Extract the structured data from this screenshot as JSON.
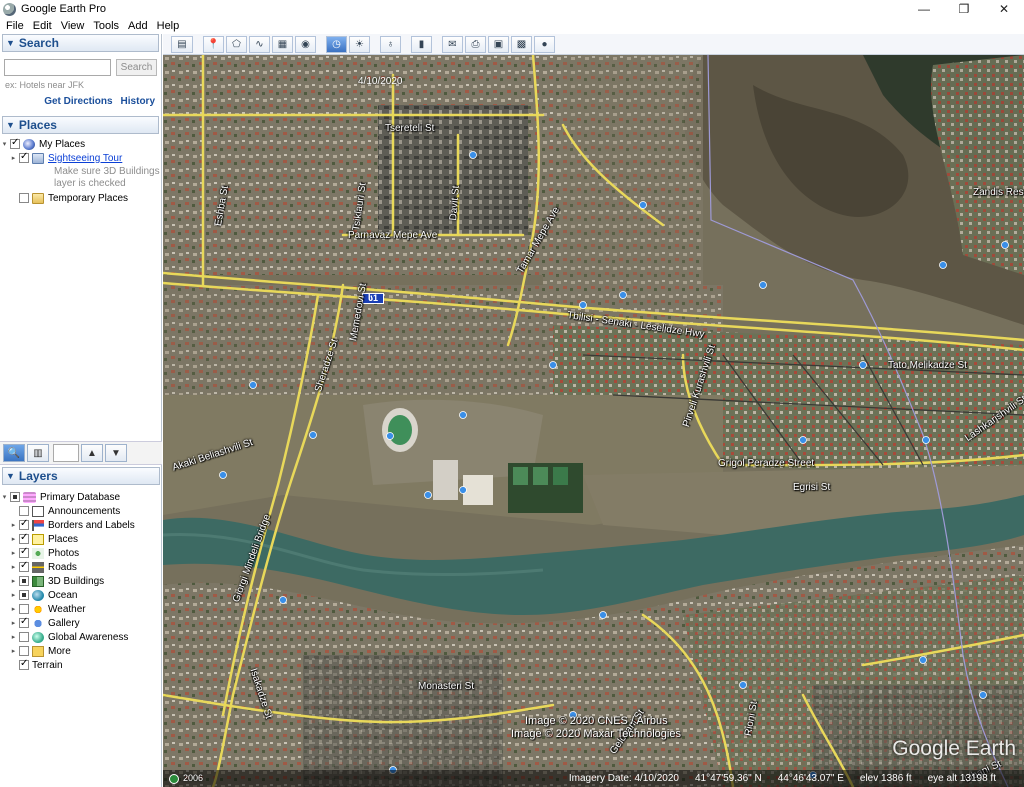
{
  "window": {
    "title": "Google Earth Pro",
    "minimize": "—",
    "maximize": "❐",
    "close": "✕"
  },
  "menu": [
    "File",
    "Edit",
    "View",
    "Tools",
    "Add",
    "Help"
  ],
  "search": {
    "header": "Search",
    "placeholder": "",
    "button": "Search",
    "hint": "ex: Hotels near JFK",
    "get_directions": "Get Directions",
    "history": "History"
  },
  "places": {
    "header": "Places",
    "my_places": "My Places",
    "sightseeing_tour": "Sightseeing Tour",
    "note_line1": "Make sure 3D Buildings",
    "note_line2": "layer is checked",
    "temporary_places": "Temporary Places"
  },
  "layers": {
    "header": "Layers",
    "primary_database": "Primary Database",
    "items": [
      {
        "label": "Announcements",
        "checked": false,
        "icon": "envelope-icon"
      },
      {
        "label": "Borders and Labels",
        "checked": true,
        "icon": "flag-icon"
      },
      {
        "label": "Places",
        "checked": true,
        "icon": "places-pin-icon"
      },
      {
        "label": "Photos",
        "checked": true,
        "icon": "photo-icon"
      },
      {
        "label": "Roads",
        "checked": true,
        "icon": "road-icon"
      },
      {
        "label": "3D Buildings",
        "checked": "partial",
        "icon": "building-icon"
      },
      {
        "label": "Ocean",
        "checked": "partial",
        "icon": "ocean-icon"
      },
      {
        "label": "Weather",
        "checked": false,
        "icon": "weather-icon"
      },
      {
        "label": "Gallery",
        "checked": true,
        "icon": "gallery-star-icon"
      },
      {
        "label": "Global Awareness",
        "checked": false,
        "icon": "globe-icon"
      },
      {
        "label": "More",
        "checked": false,
        "icon": "more-icon"
      }
    ],
    "terrain": "Terrain"
  },
  "map": {
    "date_overlay": "4/10/2020",
    "highway_shield": "ს1",
    "labels": {
      "grigol_peradze": "Grigol Peradze Street",
      "egrisi": "Egrisi St",
      "monasteri": "Monasteri St",
      "isakadze": "Isakadze St",
      "gelovani": "Gelovani St",
      "rioni": "Rioni St",
      "libani": "Libani St",
      "tato_melikadze": "Tato Melikadze St",
      "lashkarishvili": "Lashkarishvili St",
      "pirveli_kurashvili": "Pirveli Kurashvili St",
      "tbilisi_senaki": "Tbilisi - Senaki - Leselidze Hwy",
      "akaki_beliashvili": "Akaki Beliashvili St",
      "giorgi_mindeli": "Giorgi Mindeli Bridge",
      "sheradze": "Sheradze St",
      "memedovi": "Memedovi St",
      "eshba": "Eshba St",
      "tsiklauri": "Tsiklauri St",
      "davit": "Davit St",
      "parnavaz": "Parnavaz Mepe Ave",
      "tamar": "Tamar Mepe Ave",
      "tsereteli": "Tsereteli St",
      "zandi": "Zandis Res"
    },
    "copyright1": "Image © 2020 CNES / Airbus",
    "copyright2": "Image © 2020 Maxar Technologies",
    "logo": "Google Earth",
    "year": "2006",
    "status": {
      "imagery_date": "Imagery Date: 4/10/2020",
      "lat": "41°47'59.36\" N",
      "lon": "44°46'43.07\" E",
      "elev": "elev  1386 ft",
      "eye_alt": "eye alt  13198 ft"
    }
  },
  "colors": {
    "road_yellow": "#e8d85a",
    "river": "#3d6a63",
    "panel_header_text": "#1e4f8d"
  }
}
